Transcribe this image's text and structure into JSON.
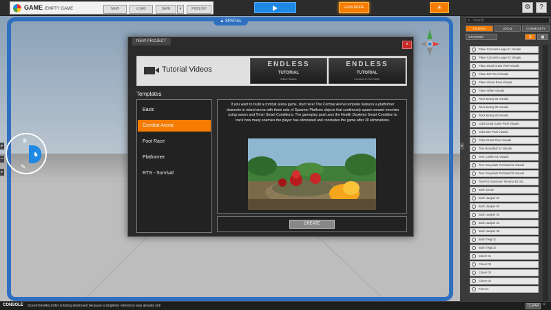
{
  "topbar": {
    "game_title": "GAME",
    "game_subtitle": "/EMPTY GAME",
    "buttons": [
      "NEW",
      "LOAD",
      "SAVE",
      "PUBLISH"
    ],
    "lens_mode": "LENS MODE"
  },
  "viewport": {
    "label": "SPATIAL"
  },
  "dialog": {
    "tab": "NEW PROJECT",
    "close": "×",
    "banner_title": "Tutorial Videos",
    "thumbs": [
      {
        "title": "ENDLESS",
        "subtitle": "TUTORIAL",
        "caption": "Editor Basics"
      },
      {
        "title": "ENDLESS",
        "subtitle": "TUTORIAL",
        "caption": "Lessons in the Editor"
      }
    ],
    "templates_label": "Templates",
    "templates": [
      "Basic",
      "Combat Arena",
      "Foot Race",
      "Platformer",
      "RTS - Survival"
    ],
    "selected_template": "Combat Arena",
    "description": "If you want to build a combat arena game, start here! The Combat Arena template features a platformer character in island arena with three sets of Spawner Platform objects that continously spawn weasel enemies using waves and Timer Smart Conditions. The gameplay goal uses the Health Depleted Smart Condition to track how many enemies the player has eliminated and concludes the game after 30 eliminations.",
    "create_label": "CREATE"
  },
  "right_panel": {
    "search_placeholder": "Search",
    "tabs": [
      "FILTERS",
      "LOCAL",
      "COMMUNITY"
    ],
    "filters_label": "FILTERS",
    "assets": [
      "Plane Concrete Large 01 Visuals",
      "Plane Concrete Large 02 Visuals",
      "Plane Dead Grass Pixel Visuals",
      "Plane Dirt Pixel Visuals",
      "Plane Green Pixel Visuals",
      "Plane White Visuals",
      "Rock Mossy 01 Visuals",
      "Rock Mossy 02 Visuals",
      "Rock Mossy 03 Visuals",
      "Cube Dead Grass Pixel Visuals",
      "Cube Dirt Pixel Visuals",
      "Cube Grass Pixel Visuals",
      "Tree Broadleaf 01 Visuals",
      "Tree Conifer 01 Visuals",
      "Tree Greyscale Terminal 01 Visuals",
      "Tree Greyscale Terminal 02 Visuals",
      "TreePot Greyscale Terminal 01 Vis...",
      "Bush Green",
      "Bush Juniper 01",
      "Bush Juniper 02",
      "Bush Juniper 03",
      "Bush Juniper 04",
      "Bush Juniper 05",
      "Bush Twig 01",
      "Bush Twig 02",
      "Clover 01",
      "Clover 02",
      "Clover 03",
      "Clover 04",
      "Fern 01"
    ]
  },
  "console": {
    "label": "CONSOLE",
    "message": "SceneViewRecorder is being destroyed because a singleton reference was already set!",
    "clear": "CLEAR",
    "close": "×"
  },
  "colors": {
    "accent_orange": "#f57c00",
    "accent_blue": "#1e88e5",
    "frame_blue": "#2f6fc0"
  }
}
